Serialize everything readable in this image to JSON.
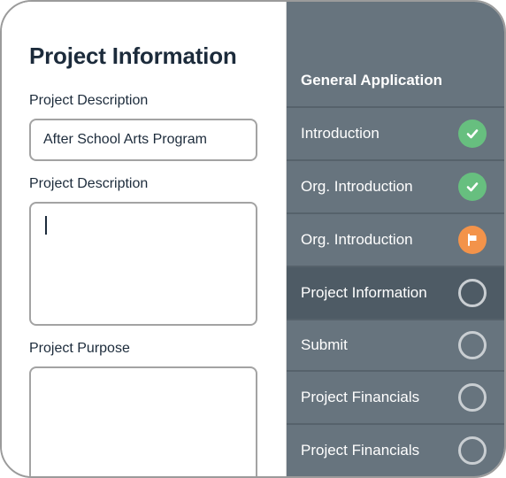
{
  "form": {
    "title": "Project Information",
    "fields": [
      {
        "label": "Project Description",
        "value": "After School Arts Program"
      },
      {
        "label": "Project Description",
        "value": ""
      },
      {
        "label": "Project Purpose",
        "value": ""
      }
    ]
  },
  "sidebar": {
    "header": "General Application",
    "steps": [
      {
        "label": "Introduction",
        "status": "complete",
        "icon": "check-icon"
      },
      {
        "label": "Org. Introduction",
        "status": "complete",
        "icon": "check-icon"
      },
      {
        "label": "Org. Introduction",
        "status": "flagged",
        "icon": "flag-icon"
      },
      {
        "label": "Project Information",
        "status": "pending",
        "active": true,
        "icon": "empty-circle-icon"
      },
      {
        "label": "Submit",
        "status": "pending",
        "icon": "empty-circle-icon"
      },
      {
        "label": "Project Financials",
        "status": "pending",
        "icon": "empty-circle-icon"
      },
      {
        "label": "Project Financials",
        "status": "pending",
        "icon": "empty-circle-icon"
      }
    ]
  },
  "colors": {
    "sidebar_bg": "#67747e",
    "sidebar_active_bg": "#4e5b65",
    "complete": "#67bf7f",
    "flagged": "#f3934a",
    "pending_ring": "#c9ced2",
    "text_dark": "#1c2b3b"
  }
}
